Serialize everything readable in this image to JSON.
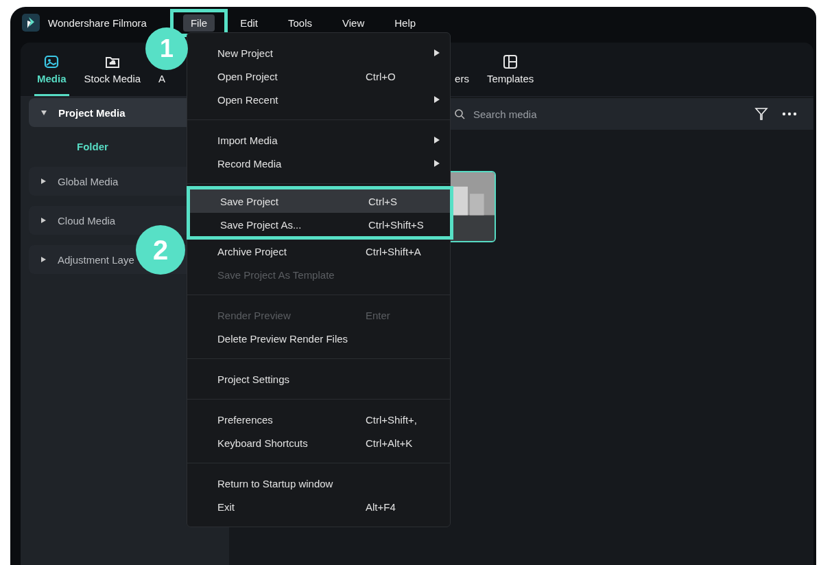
{
  "app": {
    "title": "Wondershare Filmora"
  },
  "menubar": [
    {
      "label": "File",
      "selected": true,
      "framed": true
    },
    {
      "label": "Edit",
      "selected": false,
      "framed": false
    },
    {
      "label": "Tools",
      "selected": false,
      "framed": false
    },
    {
      "label": "View",
      "selected": false,
      "framed": false
    },
    {
      "label": "Help",
      "selected": false,
      "framed": false
    }
  ],
  "tabs": [
    {
      "label": "Media",
      "kind": "media",
      "selected": true
    },
    {
      "label": "Stock Media",
      "kind": "stock",
      "selected": false
    },
    {
      "label": "A",
      "kind": "hidden",
      "selected": false
    },
    {
      "label": "ers",
      "kind": "hidden",
      "selected": false
    },
    {
      "label": "Templates",
      "kind": "templates",
      "selected": false
    }
  ],
  "sidebar": {
    "items": [
      {
        "label": "Project Media",
        "expanded": true,
        "selected": true,
        "children": [
          {
            "label": "Folder",
            "selected": true
          }
        ]
      },
      {
        "label": "Global Media",
        "expanded": false,
        "selected": false
      },
      {
        "label": "Cloud Media",
        "expanded": false,
        "selected": false
      },
      {
        "label": "Adjustment Laye",
        "expanded": false,
        "selected": false
      }
    ]
  },
  "search": {
    "placeholder": "Search media"
  },
  "media": [
    {
      "selected": true
    }
  ],
  "file_menu": {
    "groups": [
      [
        {
          "label": "New Project",
          "submenu": true,
          "disabled": false,
          "selected": false,
          "framed": false
        },
        {
          "label": "Open Project",
          "shortcut": "Ctrl+O",
          "submenu": false,
          "disabled": false,
          "selected": false,
          "framed": false
        },
        {
          "label": "Open Recent",
          "submenu": true,
          "disabled": false,
          "selected": false,
          "framed": false
        }
      ],
      [
        {
          "label": "Import Media",
          "submenu": true,
          "disabled": false,
          "selected": false,
          "framed": false
        },
        {
          "label": "Record Media",
          "submenu": true,
          "disabled": false,
          "selected": false,
          "framed": false
        }
      ],
      [
        {
          "label": "Save Project",
          "shortcut": "Ctrl+S",
          "submenu": false,
          "disabled": false,
          "selected": true,
          "framed": true
        },
        {
          "label": "Save Project As...",
          "shortcut": "Ctrl+Shift+S",
          "submenu": false,
          "disabled": false,
          "selected": false,
          "framed": true
        },
        {
          "label": "Archive Project",
          "shortcut": "Ctrl+Shift+A",
          "submenu": false,
          "disabled": false,
          "selected": false,
          "framed": false
        },
        {
          "label": "Save Project As Template",
          "submenu": false,
          "disabled": true,
          "selected": false,
          "framed": false
        }
      ],
      [
        {
          "label": "Render Preview",
          "shortcut": "Enter",
          "submenu": false,
          "disabled": true,
          "selected": false,
          "framed": false
        },
        {
          "label": "Delete Preview Render Files",
          "submenu": false,
          "disabled": false,
          "selected": false,
          "framed": false
        }
      ],
      [
        {
          "label": "Project Settings",
          "submenu": false,
          "disabled": false,
          "selected": false,
          "framed": false
        }
      ],
      [
        {
          "label": "Preferences",
          "shortcut": "Ctrl+Shift+,",
          "submenu": false,
          "disabled": false,
          "selected": false,
          "framed": false
        },
        {
          "label": "Keyboard Shortcuts",
          "shortcut": "Ctrl+Alt+K",
          "submenu": false,
          "disabled": false,
          "selected": false,
          "framed": false
        }
      ],
      [
        {
          "label": "Return to Startup window",
          "submenu": false,
          "disabled": false,
          "selected": false,
          "framed": false
        },
        {
          "label": "Exit",
          "shortcut": "Alt+F4",
          "submenu": false,
          "disabled": false,
          "selected": false,
          "framed": false
        }
      ]
    ]
  },
  "callouts": [
    {
      "number": "1"
    },
    {
      "number": "2"
    }
  ]
}
